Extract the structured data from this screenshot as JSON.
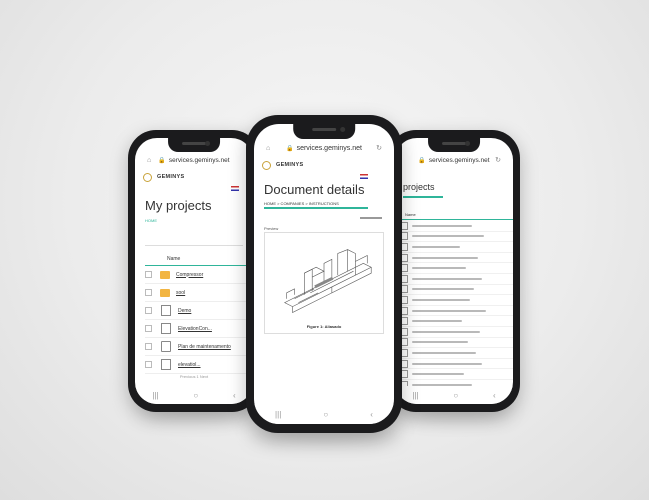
{
  "left_phone": {
    "url": "services.geminys.net",
    "brand": "GEMINYS",
    "title": "My projects",
    "breadcrumb": "HOME",
    "column_name": "Name",
    "rows": [
      {
        "name": "Compressor",
        "kind": "folder"
      },
      {
        "name": "sool",
        "kind": "folder"
      },
      {
        "name": "Demo",
        "kind": "doc"
      },
      {
        "name": "ElevationCon...",
        "kind": "doc"
      },
      {
        "name": "Plan de maintenamento",
        "kind": "file"
      },
      {
        "name": "elevatiol...",
        "kind": "doc"
      }
    ],
    "pagination": "Previous  1  Next",
    "nav": [
      "|||",
      "○",
      "‹"
    ]
  },
  "center_phone": {
    "url": "services.geminys.net",
    "brand": "GEMINYS",
    "title": "Document details",
    "breadcrumb": "HOME > COMPANIES > INSTRUCTIONS",
    "section": "Preview",
    "figure_caption": "Figure 1: Aliasado",
    "nav": [
      "|||",
      "○",
      "‹"
    ]
  },
  "right_phone": {
    "url": "services.geminys.net",
    "title": "projects",
    "column_name": "Name",
    "row_count": 17,
    "nav": [
      "|||",
      "○",
      "‹"
    ]
  },
  "colors": {
    "accent": "#2fb59a",
    "folder": "#f2b542",
    "logo": "#c9a33a"
  }
}
